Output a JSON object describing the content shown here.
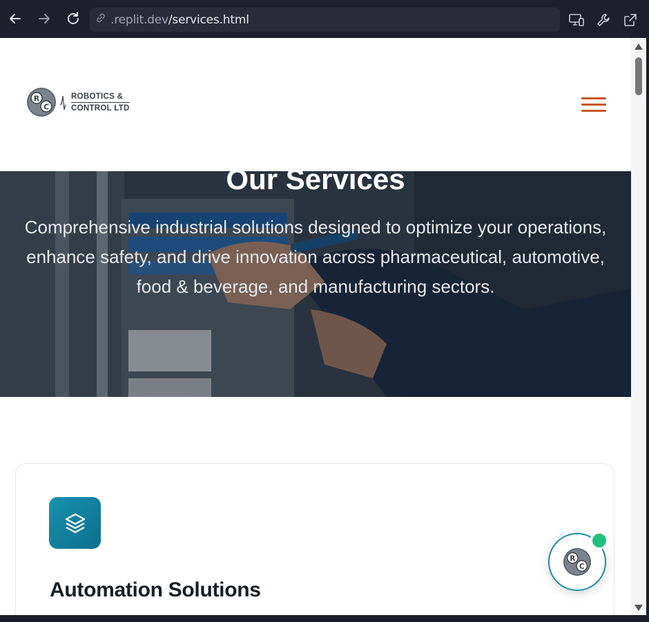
{
  "browser": {
    "url_host": ".replit.dev",
    "url_path": "/services.html",
    "icons": [
      "back-arrow-icon",
      "forward-arrow-icon",
      "reload-icon",
      "link-icon",
      "devices-icon",
      "wrench-icon",
      "external-link-icon"
    ]
  },
  "header": {
    "logo_line1": "ROBOTICS &",
    "logo_line2": "CONTROL LTD",
    "logo_letters": [
      "R",
      "C"
    ],
    "accent_color": "#c8561f"
  },
  "hero": {
    "title": "Our Services",
    "subtitle": "Comprehensive industrial solutions designed to optimize your operations, enhance safety, and drive innovation across pharmaceutical, automotive, food & beverage, and manufacturing sectors."
  },
  "services": [
    {
      "title": "Automation Solutions",
      "icon": "layers-icon",
      "icon_color": "#1891b0"
    }
  ],
  "chat_widget": {
    "logo_letters": [
      "R",
      "C"
    ],
    "status_color": "#22c07a"
  }
}
